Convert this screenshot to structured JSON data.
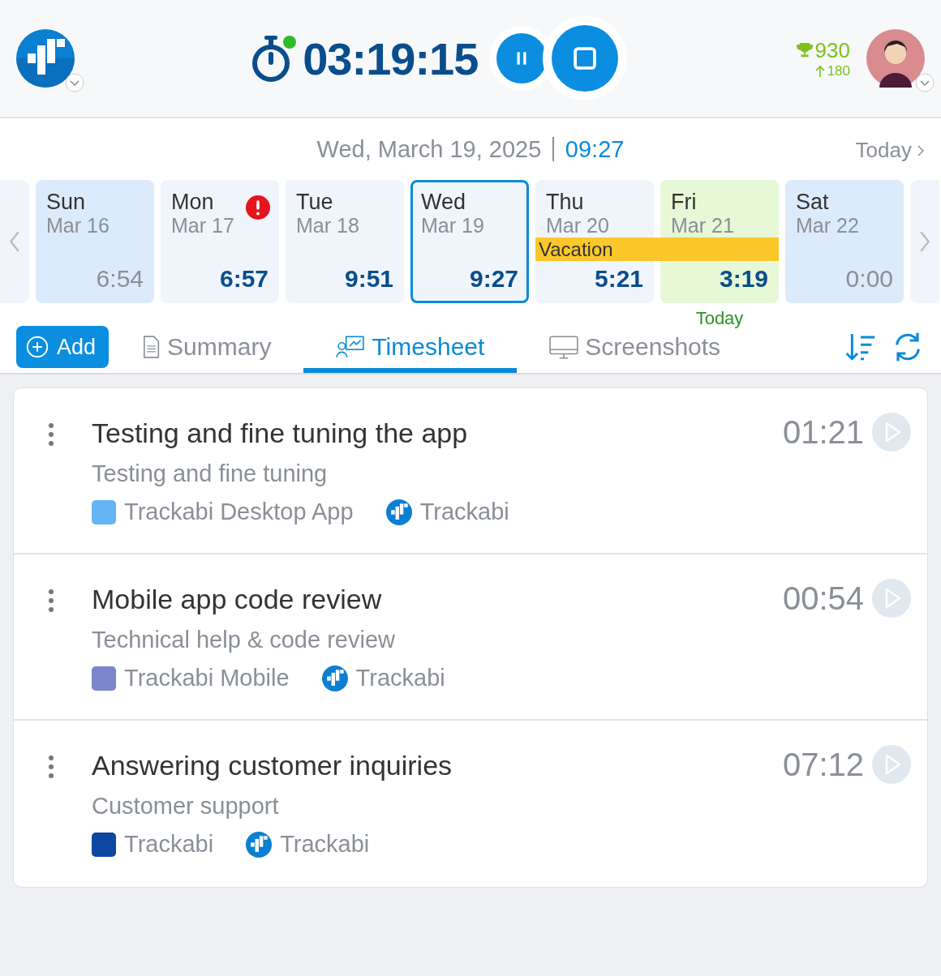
{
  "header": {
    "timer": "03:19:15",
    "timer_running": true,
    "score": "930",
    "score_change": "180"
  },
  "date_bar": {
    "date": "Wed, March 19, 2025",
    "time": "09:27",
    "today_link": "Today"
  },
  "days": [
    {
      "day": "Sun",
      "date": "Mar 16",
      "hours": "6:54",
      "weekend": true,
      "selected": false,
      "today": false,
      "alert": false
    },
    {
      "day": "Mon",
      "date": "Mar 17",
      "hours": "6:57",
      "weekend": false,
      "selected": false,
      "today": false,
      "alert": true
    },
    {
      "day": "Tue",
      "date": "Mar 18",
      "hours": "9:51",
      "weekend": false,
      "selected": false,
      "today": false,
      "alert": false
    },
    {
      "day": "Wed",
      "date": "Mar 19",
      "hours": "9:27",
      "weekend": false,
      "selected": true,
      "today": false,
      "alert": false
    },
    {
      "day": "Thu",
      "date": "Mar 20",
      "hours": "5:21",
      "weekend": false,
      "selected": false,
      "today": false,
      "alert": false,
      "event": "Vacation"
    },
    {
      "day": "Fri",
      "date": "Mar 21",
      "hours": "3:19",
      "weekend": false,
      "selected": false,
      "today": true,
      "alert": false,
      "in_event": true,
      "today_label": "Today"
    },
    {
      "day": "Sat",
      "date": "Mar 22",
      "hours": "0:00",
      "weekend": true,
      "selected": false,
      "today": false,
      "alert": false
    }
  ],
  "toolbar": {
    "add_button": "Add",
    "tabs": [
      {
        "label": "Summary",
        "kind": "summary",
        "selected": false
      },
      {
        "label": "Timesheet",
        "kind": "timesheet",
        "selected": true
      },
      {
        "label": "Screenshots",
        "kind": "screenshots",
        "selected": false
      }
    ]
  },
  "entries": [
    {
      "title": "Testing and fine tuning the app",
      "task": "Testing and fine tuning",
      "project": "Trackabi Desktop App",
      "color": "#64b5f6",
      "client": "Trackabi",
      "duration": "01:21"
    },
    {
      "title": "Mobile app code review",
      "task": "Technical help & code review",
      "project": "Trackabi Mobile",
      "color": "#7986cb",
      "client": "Trackabi",
      "duration": "00:54"
    },
    {
      "title": "Answering customer inquiries",
      "task": "Customer support",
      "project": "Trackabi",
      "color": "#0d47a1",
      "client": "Trackabi",
      "duration": "07:12"
    }
  ]
}
